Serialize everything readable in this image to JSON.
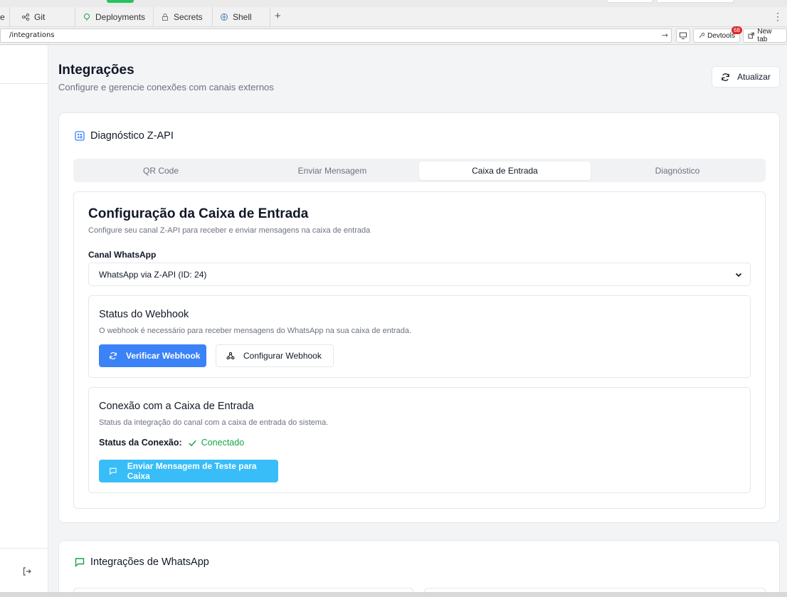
{
  "browser": {
    "tabs": [
      {
        "label": "",
        "icon": "partial-icon"
      },
      {
        "label": "Git",
        "icon": "git-icon"
      },
      {
        "label": "Deployments",
        "icon": "deploy-icon"
      },
      {
        "label": "Secrets",
        "icon": "lock-icon"
      },
      {
        "label": "Shell",
        "icon": "shell-icon"
      }
    ],
    "new_tab_symbol": "+",
    "more_symbol": "⋮",
    "url": "/integrations",
    "devtools_label": "Devtools",
    "devtools_badge": "68",
    "new_tab_label": "New tab"
  },
  "header": {
    "title": "Integrações",
    "subtitle": "Configure e gerencie conexões com canais externos",
    "refresh_label": "Atualizar"
  },
  "diagnostic_card": {
    "title": "Diagnóstico Z-API",
    "tabs": [
      "QR Code",
      "Enviar Mensagem",
      "Caixa de Entrada",
      "Diagnóstico"
    ],
    "active_tab": "Caixa de Entrada"
  },
  "inbox_config": {
    "title": "Configuração da Caixa de Entrada",
    "subtitle": "Configure seu canal Z-API para receber e enviar mensagens na caixa de entrada",
    "channel_label": "Canal WhatsApp",
    "channel_value": "WhatsApp via Z-API (ID: 24)"
  },
  "webhook": {
    "title": "Status do Webhook",
    "description": "O webhook é necessário para receber mensagens do WhatsApp na sua caixa de entrada.",
    "verify_label": "Verificar Webhook",
    "configure_label": "Configurar Webhook"
  },
  "connection": {
    "title": "Conexão com a Caixa de Entrada",
    "description": "Status da integração do canal com a caixa de entrada do sistema.",
    "status_label": "Status da Conexão:",
    "status_value": "Conectado",
    "test_label": "Enviar Mensagem de Teste para Caixa"
  },
  "whatsapp_card": {
    "title": "Integrações de WhatsApp"
  },
  "colors": {
    "primary": "#3b82f6",
    "sky": "#38bdf8",
    "success": "#16a34a",
    "badge": "#dc2626"
  }
}
